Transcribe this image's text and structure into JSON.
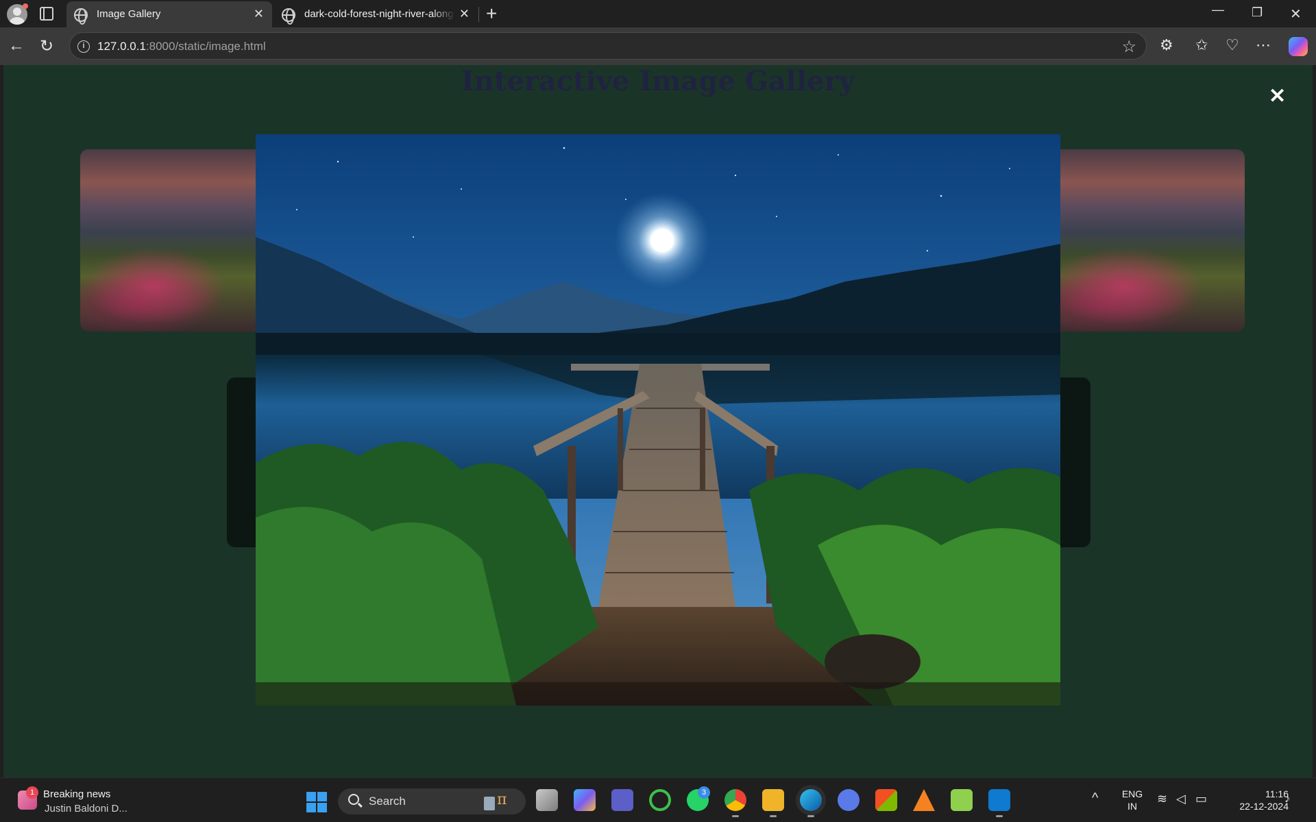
{
  "browser": {
    "tabs": [
      {
        "title": "Image Gallery",
        "active": true
      },
      {
        "title": "dark-cold-forest-night-river-along",
        "active": false
      }
    ],
    "address": {
      "host": "127.0.0.1",
      "path": ":8000/static/image.html"
    },
    "icons": {
      "back": "back-arrow-icon",
      "reload": "reload-icon",
      "favorite": "star-icon",
      "extensions": "puzzle-icon",
      "favorites": "favorites-icon",
      "health": "browser-essentials-icon",
      "more": "more-icon",
      "copilot": "copilot-icon"
    }
  },
  "page": {
    "title": "Interactive Image Gallery",
    "modal_close": "✕",
    "background_color": "#1b3428",
    "title_color": "#1f2340"
  },
  "taskbar": {
    "news": {
      "badge": "1",
      "title": "Breaking news",
      "subtitle": "Justin Baldoni D..."
    },
    "search_label": "Search",
    "whatsapp_badge": "3",
    "language": {
      "line1": "ENG",
      "line2": "IN"
    },
    "clock": {
      "time": "11:16",
      "date": "22-12-2024"
    }
  }
}
